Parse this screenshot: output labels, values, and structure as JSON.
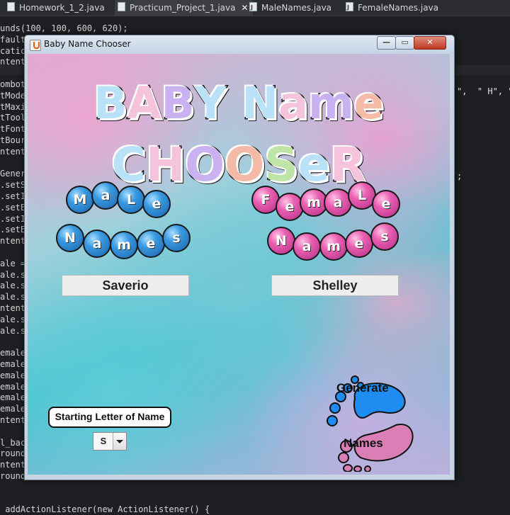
{
  "ide": {
    "tabs": [
      {
        "label": "Homework_1_2.java",
        "active": false
      },
      {
        "label": "Practicum_Project_1.java",
        "active": true,
        "close": "✕"
      },
      {
        "label": "MaleNames.java",
        "active": false
      },
      {
        "label": "FemaleNames.java",
        "active": false
      }
    ],
    "code_lines": [
      "unds(100, 100, 600, 620);",
      "fault",
      "catic",
      "ntent",
      "",
      "ombot",
      "tMode",
      "tMaxi",
      "tTool",
      "tFont",
      "tBour",
      "ntent",
      "",
      "Gener",
      ".setS",
      ".setI",
      ".setE",
      ".setI",
      ".setE",
      "ntent",
      "",
      "ale =",
      "ale.s",
      "ale.s",
      "ale.s",
      "ntent",
      "ale.s",
      "ale.s",
      "",
      "emale",
      "emale",
      "emale",
      "emale",
      "emale",
      "emale",
      "ntent",
      "",
      "l_bac",
      "round",
      "ntent",
      "round",
      "",
      "",
      " addActionListener(new ActionListener() {"
    ],
    "right_code": "\",  \" H\", \"",
    "right_code2": ";"
  },
  "window": {
    "title": "Baby Name Chooser",
    "buttons": {
      "minimize": "—",
      "maximize": "▭",
      "close": "✕"
    }
  },
  "app": {
    "title_line1": [
      "B",
      "A",
      "B",
      "Y",
      " ",
      "N",
      "a",
      "m",
      "e"
    ],
    "title_line2": [
      "C",
      "H",
      "O",
      "O",
      "S",
      "e",
      "R"
    ],
    "title_colors1": [
      "#b9e1f8",
      "#f6c3dd",
      "#c9b2ef",
      "#b9e1f8",
      "",
      "#b9e1f8",
      "#f6c3dd",
      "#c9b2ef",
      "#f4b9a7"
    ],
    "title_colors2": [
      "#b9e1f8",
      "#f6c3dd",
      "#c9b2ef",
      "#f4b9a7",
      "#bfe4a8",
      "#b9e1f8",
      "#f6c3dd"
    ],
    "male_label_word1": [
      "M",
      "a",
      "L",
      "e"
    ],
    "male_label_word2": [
      "N",
      "a",
      "m",
      "e",
      "s"
    ],
    "female_label_word1": [
      "F",
      "e",
      "m",
      "a",
      "L",
      "e"
    ],
    "female_label_word2": [
      "N",
      "a",
      "m",
      "e",
      "s"
    ],
    "male_name": "Saverio",
    "female_name": "Shelley",
    "starting_letter_label": "Starting Letter of Name",
    "starting_letter_value": "S",
    "generate_line1": "Generate",
    "generate_line2": "Names",
    "footprint_colors": {
      "top": "#1e8cf0",
      "bottom": "#d97fb5"
    }
  }
}
